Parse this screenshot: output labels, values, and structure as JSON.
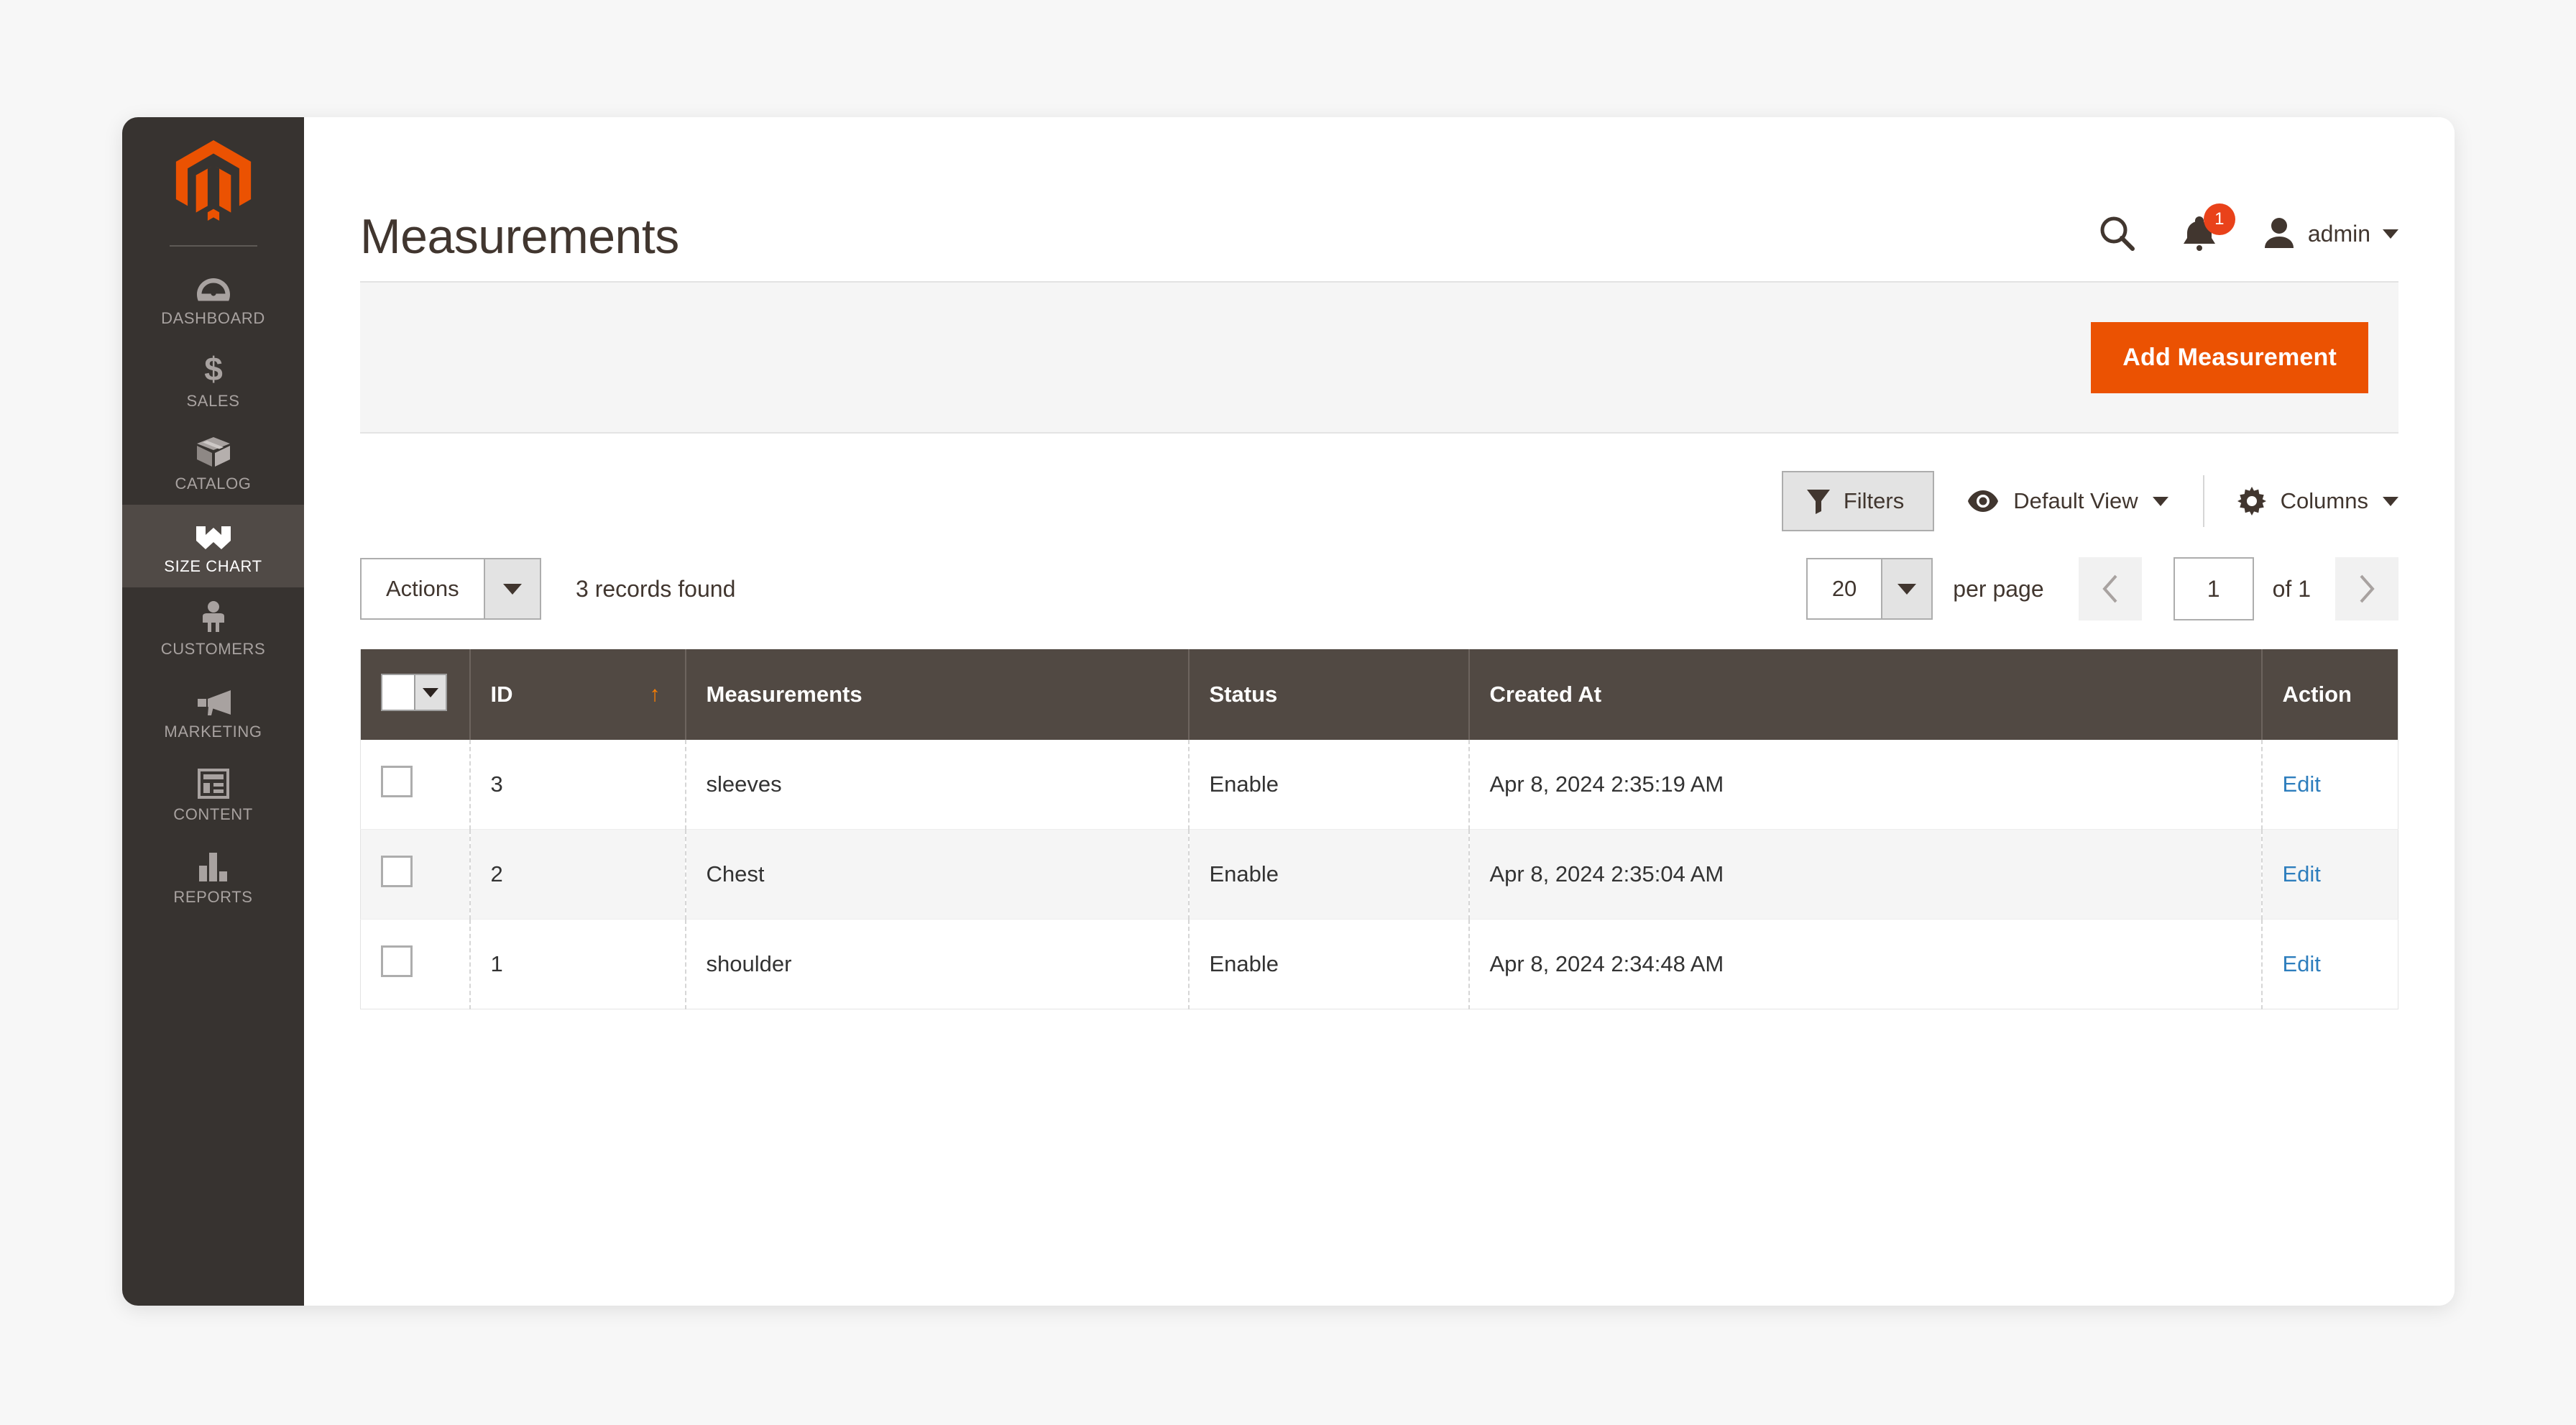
{
  "brand": {
    "logo_icon": "magento-logo-icon",
    "accent_color": "#eb5202",
    "sidebar_color": "#373330",
    "table_header_color": "#514943",
    "link_color": "#2e7ebd"
  },
  "sidebar": {
    "items": [
      {
        "label": "Dashboard",
        "icon": "dashboard-gauge-icon",
        "active": false
      },
      {
        "label": "Sales",
        "icon": "dollar-sign-icon",
        "active": false
      },
      {
        "label": "Catalog",
        "icon": "box-icon",
        "active": false
      },
      {
        "label": "Size Chart",
        "icon": "size-chart-icon",
        "active": true
      },
      {
        "label": "Customers",
        "icon": "person-group-icon",
        "active": false
      },
      {
        "label": "Marketing",
        "icon": "megaphone-icon",
        "active": false
      },
      {
        "label": "Content",
        "icon": "layout-page-icon",
        "active": false
      },
      {
        "label": "Reports",
        "icon": "bar-chart-icon",
        "active": false
      }
    ]
  },
  "header": {
    "title": "Measurements",
    "search_icon": "search-icon",
    "notifications_icon": "bell-icon",
    "notifications_count": "1",
    "user_icon": "user-avatar-icon",
    "user_name": "admin",
    "user_caret_icon": "chevron-down-icon"
  },
  "page_actions": {
    "add_button_label": "Add Measurement"
  },
  "grid_toolbar": {
    "filters_label": "Filters",
    "filters_icon": "funnel-icon",
    "view_label": "Default View",
    "view_icon": "eye-icon",
    "columns_label": "Columns",
    "columns_icon": "gear-icon",
    "dropdown_icon": "chevron-down-icon"
  },
  "grid_controls": {
    "actions_label": "Actions",
    "records_found": "3 records found",
    "per_page_value": "20",
    "per_page_label": "per page",
    "prev_icon": "chevron-left-icon",
    "next_icon": "chevron-right-icon",
    "page_value": "1",
    "page_total": "of 1"
  },
  "grid": {
    "columns": [
      {
        "key": "check",
        "label": ""
      },
      {
        "key": "id",
        "label": "ID",
        "sort": "asc"
      },
      {
        "key": "name",
        "label": "Measurements"
      },
      {
        "key": "status",
        "label": "Status"
      },
      {
        "key": "created",
        "label": "Created At"
      },
      {
        "key": "action",
        "label": "Action"
      }
    ],
    "rows": [
      {
        "id": "3",
        "name": "sleeves",
        "status": "Enable",
        "created": "Apr 8, 2024 2:35:19 AM",
        "action": "Edit"
      },
      {
        "id": "2",
        "name": "Chest",
        "status": "Enable",
        "created": "Apr 8, 2024 2:35:04 AM",
        "action": "Edit"
      },
      {
        "id": "1",
        "name": "shoulder",
        "status": "Enable",
        "created": "Apr 8, 2024 2:34:48 AM",
        "action": "Edit"
      }
    ]
  }
}
